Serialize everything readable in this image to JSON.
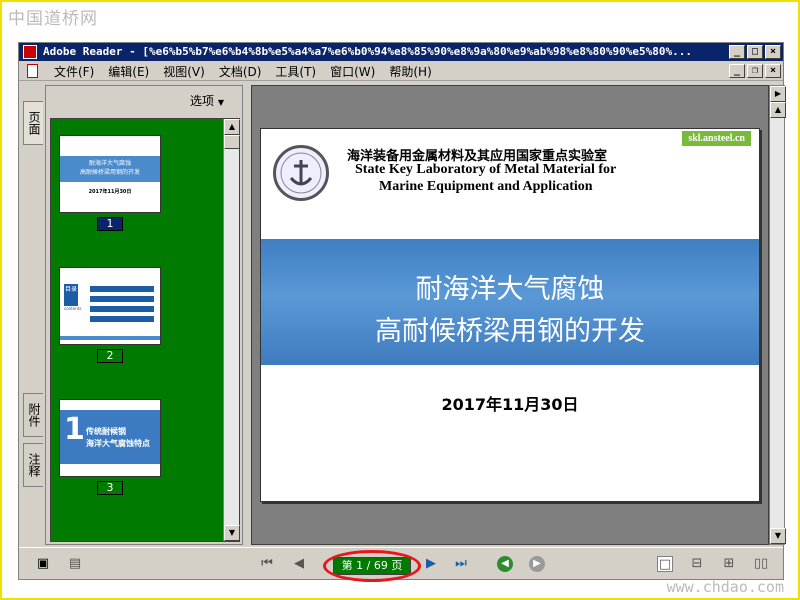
{
  "watermarks": {
    "top": "中国道桥网",
    "bottom": "www.chdao.com"
  },
  "window": {
    "title": "Adobe Reader - [%e6%b5%b7%e6%b4%8b%e5%a4%a7%e6%b0%94%e8%85%90%e8%9a%80%e9%ab%98%e8%80%90%e5%80%...",
    "btn_min": "_",
    "btn_max": "□",
    "btn_close": "×"
  },
  "menu": {
    "items": [
      "文件(F)",
      "编辑(E)",
      "视图(V)",
      "文档(D)",
      "工具(T)",
      "窗口(W)",
      "帮助(H)"
    ],
    "btn_min": "_",
    "btn_restore": "❐",
    "btn_close": "×"
  },
  "side_tabs": {
    "pages": "页面",
    "attachments": "附件",
    "comments": "注释"
  },
  "nav_panel": {
    "options_label": "选项",
    "thumbnails": [
      {
        "label": "1",
        "title1": "耐海洋大气腐蚀",
        "title2": "高耐候桥梁用钢的开发",
        "date": "2017年11月30日"
      },
      {
        "label": "2",
        "heading": "目录",
        "heading_en": "contents"
      },
      {
        "label": "3",
        "num": "1",
        "line1": "传统耐候钢",
        "line2": "海洋大气腐蚀特点"
      }
    ]
  },
  "slide": {
    "lab_cn": "海洋装备用金属材料及其应用国家重点实验室",
    "lab_en1": "State Key Laboratory of Metal Material for",
    "lab_en2": "Marine Equipment and Application",
    "url": "skl.ansteel.cn",
    "title1": "耐海洋大气腐蚀",
    "title2": "高耐候桥梁用钢的开发",
    "date": "2017年11月30日"
  },
  "statusbar": {
    "page_indicator": "第 1 / 69 页"
  },
  "colors": {
    "title_bar": "#0a246a",
    "thumb_bg": "#007a00",
    "highlight_ring": "#e8161b",
    "banner": "#4a8bcb"
  }
}
